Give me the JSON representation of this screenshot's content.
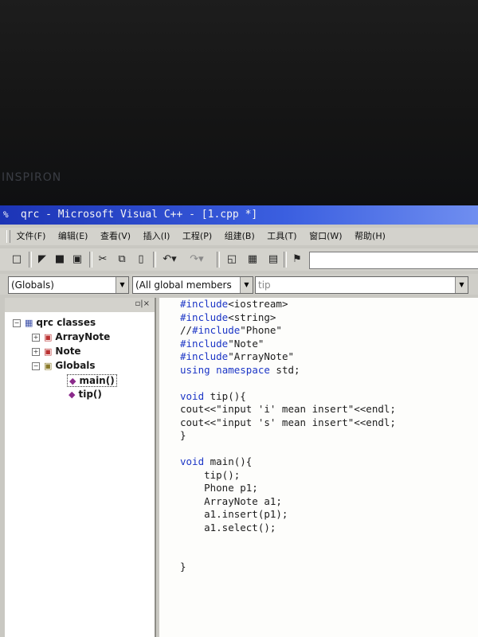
{
  "window": {
    "title": "qrc - Microsoft Visual C++ - [1.cpp *]",
    "title_icon": "vc-app-icon"
  },
  "monitor": {
    "brand": "INSPIRON"
  },
  "menu": [
    "文件(F)",
    "编辑(E)",
    "查看(V)",
    "插入(I)",
    "工程(P)",
    "组建(B)",
    "工具(T)",
    "窗口(W)",
    "帮助(H)"
  ],
  "toolbar": {
    "icons": [
      "new-file-icon",
      "open-folder-icon",
      "save-icon",
      "save-all-icon",
      "cut-icon",
      "copy-icon",
      "paste-icon",
      "undo-icon",
      "redo-icon",
      "workspace-icon",
      "output-icon",
      "window-list-icon",
      "find-in-files-icon"
    ],
    "find_value": ""
  },
  "wizardbar": {
    "scope": "(Globals)",
    "filter": "(All global members",
    "member": "tip"
  },
  "classview": {
    "root": "qrc classes",
    "items": [
      {
        "label": "ArrayNote",
        "icon": "class-icon"
      },
      {
        "label": "Note",
        "icon": "class-icon"
      },
      {
        "label": "Globals",
        "icon": "folder-icon"
      },
      {
        "label": "main()",
        "icon": "function-icon"
      },
      {
        "label": "tip()",
        "icon": "function-icon"
      }
    ]
  },
  "code_lines": [
    "#include<iostream>",
    "#include<string>",
    "//#include\"Phone\"",
    "#include\"Note\"",
    "#include\"ArrayNote\"",
    "using namespace std;",
    "",
    "void tip(){",
    "cout<<\"input 'i' mean insert\"<<endl;",
    "cout<<\"input 's' mean insert\"<<endl;",
    "}",
    "",
    "void main(){",
    "    tip();",
    "    Phone p1;",
    "    ArrayNote a1;",
    "    a1.insert(p1);",
    "    a1.select();",
    "",
    "",
    "}"
  ]
}
